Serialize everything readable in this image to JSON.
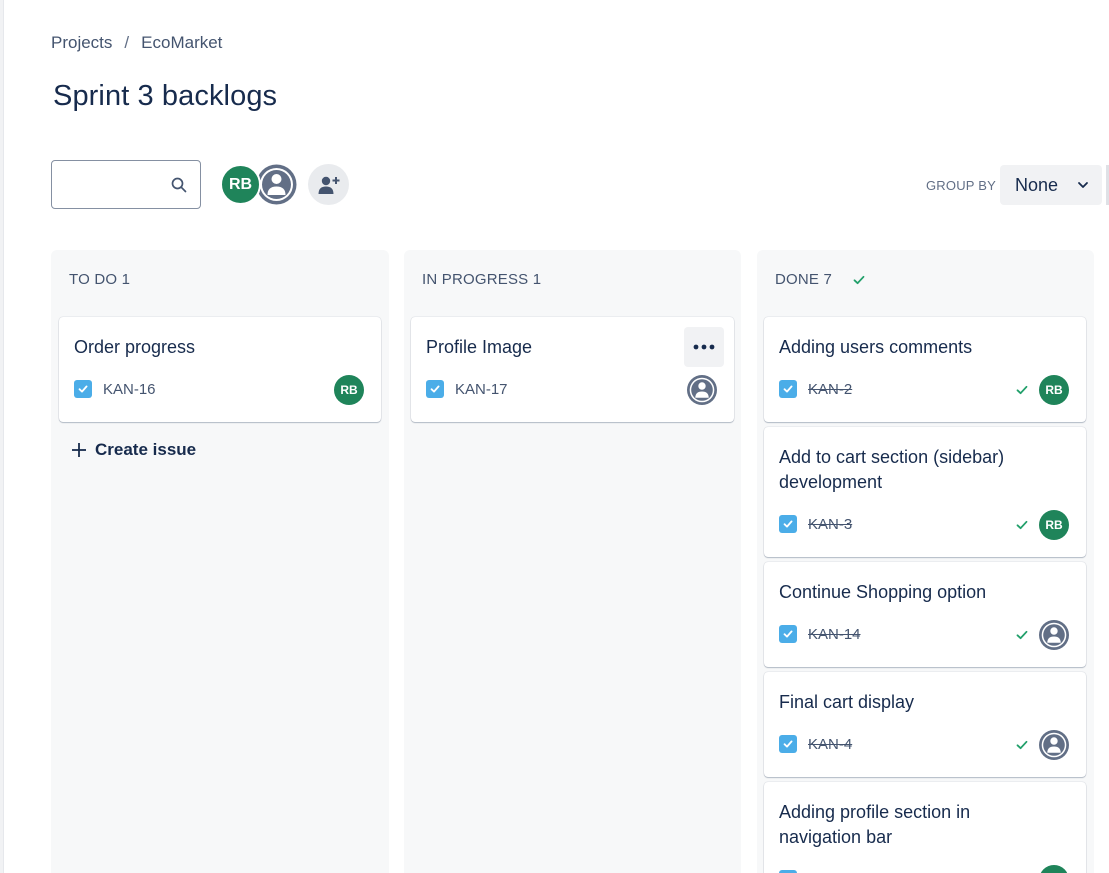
{
  "breadcrumb": {
    "items": [
      "Projects",
      "EcoMarket"
    ],
    "separator": "/"
  },
  "page": {
    "title": "Sprint 3 backlogs"
  },
  "search": {
    "value": "",
    "placeholder": ""
  },
  "people": {
    "rb_initials": "RB"
  },
  "group_by": {
    "label": "GROUP BY",
    "value": "None"
  },
  "columns": [
    {
      "header": "TO DO 1",
      "cards": [
        {
          "title": "Order progress",
          "key": "KAN-16",
          "assignee": "RB",
          "done": false
        }
      ],
      "create_label": "Create issue"
    },
    {
      "header": "IN PROGRESS 1",
      "cards": [
        {
          "title": "Profile Image",
          "key": "KAN-17",
          "assignee": "user-icon",
          "done": false
        }
      ]
    },
    {
      "header": "DONE 7",
      "cards": [
        {
          "title": "Adding users comments",
          "key": "KAN-2",
          "assignee": "RB",
          "done": true
        },
        {
          "title": "Add to cart section (sidebar) development",
          "key": "KAN-3",
          "assignee": "RB",
          "done": true
        },
        {
          "title": "Continue Shopping option",
          "key": "KAN-14",
          "assignee": "user-icon",
          "done": true
        },
        {
          "title": "Final cart display",
          "key": "KAN-4",
          "assignee": "user-icon",
          "done": true
        },
        {
          "title": "Adding profile section in navigation bar",
          "key": "",
          "assignee": "RB",
          "done": true
        }
      ]
    }
  ],
  "colors": {
    "accent_green": "#1f845a",
    "task_blue": "#4bade8",
    "done_check": "#22a06b",
    "text": "#172b4d"
  }
}
